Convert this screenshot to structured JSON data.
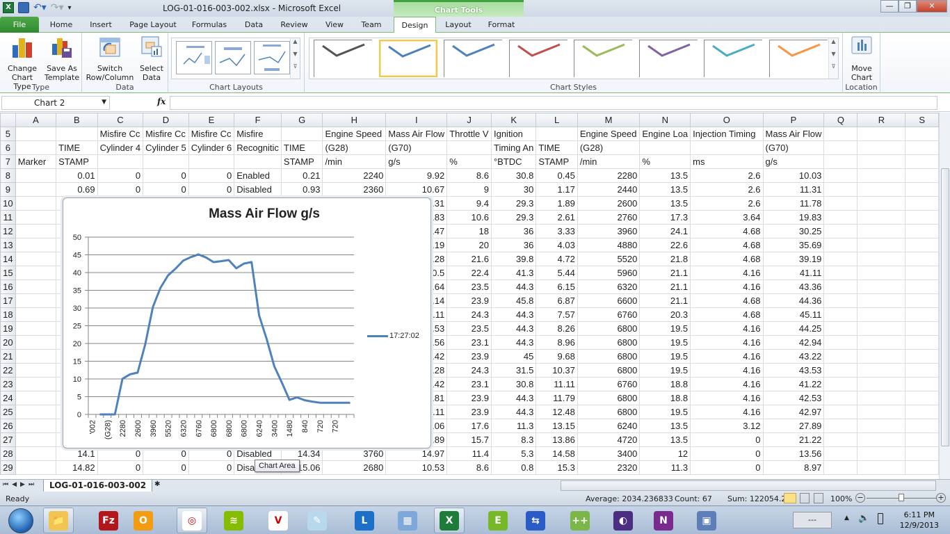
{
  "window": {
    "title": "LOG-01-016-003-002.xlsx - Microsoft Excel",
    "contextual_tab_group": "Chart Tools",
    "controls": {
      "minimize": "—",
      "restore": "❐",
      "close": "✕"
    }
  },
  "ribbon_tabs": [
    {
      "label": "File"
    },
    {
      "label": "Home"
    },
    {
      "label": "Insert"
    },
    {
      "label": "Page Layout"
    },
    {
      "label": "Formulas"
    },
    {
      "label": "Data"
    },
    {
      "label": "Review"
    },
    {
      "label": "View"
    },
    {
      "label": "Team"
    },
    {
      "label": "Design",
      "active": true
    },
    {
      "label": "Layout"
    },
    {
      "label": "Format"
    }
  ],
  "ribbon": {
    "groups": {
      "type": {
        "label": "Type",
        "buttons": [
          "Change Chart Type",
          "Save As Template"
        ]
      },
      "data": {
        "label": "Data",
        "buttons": [
          "Switch Row/Column",
          "Select Data"
        ]
      },
      "chart_layouts": {
        "label": "Chart Layouts"
      },
      "chart_styles": {
        "label": "Chart Styles",
        "colors": [
          "#555555",
          "#4f81bd",
          "#4f81bd",
          "#c0504d",
          "#9bbb59",
          "#8064a2",
          "#4bacc6",
          "#f79646"
        ],
        "selected_index": 1
      },
      "location": {
        "label": "Location",
        "buttons": [
          "Move Chart"
        ]
      }
    }
  },
  "formula_bar": {
    "name_box": "Chart 2",
    "fx_label": "fx",
    "formula": ""
  },
  "columns": [
    "A",
    "B",
    "C",
    "D",
    "E",
    "F",
    "G",
    "H",
    "I",
    "J",
    "K",
    "L",
    "M",
    "N",
    "O",
    "P",
    "Q",
    "R",
    "S"
  ],
  "rows": [
    {
      "n": "5",
      "cells": [
        "",
        "",
        "Misfire Cc",
        "Misfire Cc",
        "Misfire Cc",
        "Misfire",
        "",
        "Engine Speed",
        "Mass Air Flow",
        "Throttle V",
        "Ignition",
        "",
        "Engine Speed",
        "Engine Loa",
        "Injection Timing",
        "Mass Air Flow",
        "",
        "",
        ""
      ]
    },
    {
      "n": "6",
      "cells": [
        "",
        "TIME",
        "Cylinder 4",
        "Cylinder 5",
        "Cylinder 6",
        "Recognitic",
        "TIME",
        "(G28)",
        "(G70)",
        "",
        "Timing An",
        "TIME",
        "(G28)",
        "",
        "",
        "(G70)",
        "",
        "",
        ""
      ]
    },
    {
      "n": "7",
      "cells": [
        "Marker",
        "STAMP",
        "",
        "",
        "",
        "",
        "STAMP",
        " /min",
        " g/s",
        "%",
        "°BTDC",
        "STAMP",
        " /min",
        "%",
        " ms",
        " g/s",
        "",
        "",
        ""
      ]
    },
    {
      "n": "8",
      "cells": [
        "",
        "0.01",
        "0",
        "0",
        "0",
        "Enabled",
        "0.21",
        "2240",
        "9.92",
        "8.6",
        "30.8",
        "0.45",
        "2280",
        "13.5",
        "2.6",
        "10.03",
        "",
        "",
        ""
      ]
    },
    {
      "n": "9",
      "cells": [
        "",
        "0.69",
        "0",
        "0",
        "0",
        "Disabled",
        "0.93",
        "2360",
        "10.67",
        "9",
        "30",
        "1.17",
        "2440",
        "13.5",
        "2.6",
        "11.31",
        "",
        "",
        ""
      ]
    },
    {
      "n": "10",
      "cells": [
        "",
        "",
        "",
        "",
        "",
        "",
        "",
        "",
        "11.31",
        "9.4",
        "29.3",
        "1.89",
        "2600",
        "13.5",
        "2.6",
        "11.78",
        "",
        "",
        ""
      ]
    },
    {
      "n": "11",
      "cells": [
        "",
        "",
        "",
        "",
        "",
        "",
        "",
        "",
        "12.83",
        "10.6",
        "29.3",
        "2.61",
        "2760",
        "17.3",
        "3.64",
        "19.83",
        "",
        "",
        ""
      ]
    },
    {
      "n": "12",
      "cells": [
        "",
        "",
        "",
        "",
        "",
        "",
        "",
        "",
        "28.47",
        "18",
        "36",
        "3.33",
        "3960",
        "24.1",
        "4.68",
        "30.25",
        "",
        "",
        ""
      ]
    },
    {
      "n": "13",
      "cells": [
        "",
        "",
        "",
        "",
        "",
        "",
        "",
        "",
        "34.19",
        "20",
        "36",
        "4.03",
        "4880",
        "22.6",
        "4.68",
        "35.69",
        "",
        "",
        ""
      ]
    },
    {
      "n": "14",
      "cells": [
        "",
        "",
        "",
        "",
        "",
        "",
        "",
        "",
        "38.28",
        "21.6",
        "39.8",
        "4.72",
        "5520",
        "21.8",
        "4.68",
        "39.19",
        "",
        "",
        ""
      ]
    },
    {
      "n": "15",
      "cells": [
        "",
        "",
        "",
        "",
        "",
        "",
        "",
        "",
        "40.5",
        "22.4",
        "41.3",
        "5.44",
        "5960",
        "21.1",
        "4.16",
        "41.11",
        "",
        "",
        ""
      ]
    },
    {
      "n": "16",
      "cells": [
        "",
        "",
        "",
        "",
        "",
        "",
        "",
        "",
        "42.64",
        "23.5",
        "44.3",
        "6.15",
        "6320",
        "21.1",
        "4.16",
        "43.36",
        "",
        "",
        ""
      ]
    },
    {
      "n": "17",
      "cells": [
        "",
        "",
        "",
        "",
        "",
        "",
        "",
        "",
        "44.14",
        "23.9",
        "45.8",
        "6.87",
        "6600",
        "21.1",
        "4.68",
        "44.36",
        "",
        "",
        ""
      ]
    },
    {
      "n": "18",
      "cells": [
        "",
        "",
        "",
        "",
        "",
        "",
        "",
        "",
        "45.11",
        "24.3",
        "44.3",
        "7.57",
        "6760",
        "20.3",
        "4.68",
        "45.11",
        "",
        "",
        ""
      ]
    },
    {
      "n": "19",
      "cells": [
        "",
        "",
        "",
        "",
        "",
        "",
        "",
        "",
        "42.53",
        "23.5",
        "44.3",
        "8.26",
        "6800",
        "19.5",
        "4.16",
        "44.25",
        "",
        "",
        ""
      ]
    },
    {
      "n": "20",
      "cells": [
        "",
        "",
        "",
        "",
        "",
        "",
        "",
        "",
        "42.56",
        "23.1",
        "44.3",
        "8.96",
        "6800",
        "19.5",
        "4.16",
        "42.94",
        "",
        "",
        ""
      ]
    },
    {
      "n": "21",
      "cells": [
        "",
        "",
        "",
        "",
        "",
        "",
        "",
        "",
        "43.42",
        "23.9",
        "45",
        "9.68",
        "6800",
        "19.5",
        "4.16",
        "43.22",
        "",
        "",
        ""
      ]
    },
    {
      "n": "22",
      "cells": [
        "",
        "",
        "",
        "",
        "",
        "",
        "",
        "",
        "44.28",
        "24.3",
        "31.5",
        "10.37",
        "6800",
        "19.5",
        "4.16",
        "43.53",
        "",
        "",
        ""
      ]
    },
    {
      "n": "23",
      "cells": [
        "",
        "",
        "",
        "",
        "",
        "",
        "",
        "",
        "42.42",
        "23.1",
        "30.8",
        "11.11",
        "6760",
        "18.8",
        "4.16",
        "41.22",
        "",
        "",
        ""
      ]
    },
    {
      "n": "24",
      "cells": [
        "",
        "",
        "",
        "",
        "",
        "",
        "",
        "",
        "43.81",
        "23.9",
        "44.3",
        "11.79",
        "6800",
        "18.8",
        "4.16",
        "42.53",
        "",
        "",
        ""
      ]
    },
    {
      "n": "25",
      "cells": [
        "",
        "",
        "",
        "",
        "",
        "",
        "",
        "",
        "44.11",
        "23.9",
        "44.3",
        "12.48",
        "6800",
        "19.5",
        "4.16",
        "42.97",
        "",
        "",
        ""
      ]
    },
    {
      "n": "26",
      "cells": [
        "",
        "",
        "",
        "",
        "",
        "",
        "",
        "",
        "30.06",
        "17.6",
        "11.3",
        "13.15",
        "6240",
        "13.5",
        "3.12",
        "27.89",
        "",
        "",
        ""
      ]
    },
    {
      "n": "27",
      "cells": [
        "",
        "",
        "",
        "",
        "",
        "",
        "",
        "",
        "23.89",
        "15.7",
        "8.3",
        "13.86",
        "4720",
        "13.5",
        "0",
        "21.22",
        "",
        "",
        ""
      ]
    },
    {
      "n": "28",
      "cells": [
        "",
        "14.1",
        "0",
        "0",
        "0",
        "Disabled",
        "14.34",
        "3760",
        "14.97",
        "11.4",
        "5.3",
        "14.58",
        "3400",
        "12",
        "0",
        "13.56",
        "",
        "",
        ""
      ]
    },
    {
      "n": "29",
      "cells": [
        "",
        "14.82",
        "0",
        "0",
        "0",
        "Disabled",
        "15.06",
        "2680",
        "10.53",
        "8.6",
        "0.8",
        "15.3",
        "2320",
        "11.3",
        "0",
        "8.97",
        "",
        "",
        ""
      ]
    }
  ],
  "chart_data": {
    "type": "line",
    "title": "Mass Air Flow g/s",
    "xlabel": "",
    "ylabel": "",
    "ylim": [
      0,
      50
    ],
    "yticks": [
      0,
      5,
      10,
      15,
      20,
      25,
      30,
      35,
      40,
      45,
      50
    ],
    "grid": true,
    "legend_position": "right",
    "x_tick_labels": [
      "'002",
      "(G28)",
      "2280",
      "2600",
      "3960",
      "5520",
      "6320",
      "6760",
      "6800",
      "6800",
      "6800",
      "6240",
      "3400",
      "1480",
      "840",
      "720",
      "720"
    ],
    "series": [
      {
        "name": "17:27:02",
        "color": "#4f81bd",
        "values": [
          null,
          0,
          0,
          0,
          10.03,
          11.31,
          11.78,
          19.83,
          30.25,
          35.69,
          39.19,
          41.11,
          43.36,
          44.36,
          45.11,
          44.25,
          42.94,
          43.22,
          43.53,
          41.22,
          42.53,
          42.97,
          27.89,
          21.22,
          13.56,
          8.97,
          4.1,
          4.8,
          4.0,
          3.6,
          3.3,
          3.3,
          3.3,
          3.3,
          3.3
        ]
      }
    ]
  },
  "tooltip": "Chart Area",
  "sheet_tabs": [
    {
      "label": "LOG-01-016-003-002",
      "active": true
    }
  ],
  "status_bar": {
    "mode": "Ready",
    "average": "Average: 2034.236833",
    "count": "Count: 67",
    "sum": "Sum: 122054.21",
    "zoom": "100%"
  },
  "taskbar": {
    "apps": [
      "Windows Explorer",
      "FileZilla",
      "Outlook",
      "Chrome",
      "Spotify",
      "VNC Viewer",
      "Notepad",
      "Lync",
      "Calculator",
      "Excel",
      "Evernote",
      "Remote Desktop",
      "Notepad++",
      "Eclipse",
      "OneNote",
      "VirtualBox"
    ],
    "time": "6:11 PM",
    "date": "12/9/2013",
    "battery_label": "---"
  }
}
